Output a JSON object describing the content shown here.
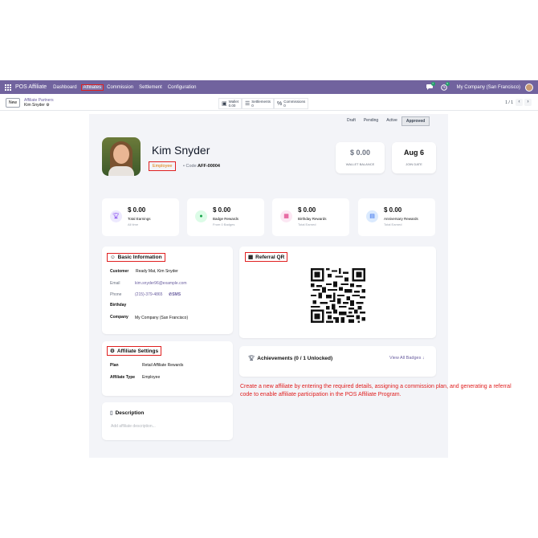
{
  "navbar": {
    "brand": "POS Affiliate",
    "menus": [
      "Dashboard",
      "Affiliates",
      "Commission",
      "Settlement",
      "Configuration"
    ],
    "active_menu_index": 1,
    "notif_count": "7",
    "activity_count": "5",
    "company": "My Company (San Francisco)"
  },
  "control": {
    "new_label": "New",
    "breadcrumb_parent": "Affiliate Partners",
    "breadcrumb_current": "Kim Snyder",
    "stats": [
      {
        "label": "Wallet",
        "value": "0.00"
      },
      {
        "label": "Settlements",
        "value": "0"
      },
      {
        "label": "Commissions",
        "value": "0"
      }
    ],
    "pager": "1 / 1"
  },
  "status": {
    "stages": [
      "Draft",
      "Pending",
      "Active",
      "Approved"
    ],
    "current_index": 3
  },
  "header": {
    "name": "Kim Snyder",
    "type_badge": "Employee",
    "code_label": "Code:",
    "code": "AFF-00004",
    "wallet_value": "$ 0.00",
    "wallet_label": "WALLET BALANCE",
    "join_value": "Aug 6",
    "join_label": "JOIN DATE"
  },
  "rewards": [
    {
      "value": "$ 0.00",
      "title": "Total Earnings",
      "sub": "All time",
      "icon": "trophy-icon",
      "color": "#ede9fe"
    },
    {
      "value": "$ 0.00",
      "title": "Badge Rewards",
      "sub": "From 0 Badges",
      "icon": "badge-icon",
      "color": "#dcfce7"
    },
    {
      "value": "$ 0.00",
      "title": "Birthday Rewards",
      "sub": "Total Earned",
      "icon": "cake-icon",
      "color": "#fce7f3"
    },
    {
      "value": "$ 0.00",
      "title": "Anniversary Rewards",
      "sub": "Total Earned",
      "icon": "calendar-icon",
      "color": "#dbeafe"
    }
  ],
  "basic": {
    "title": "Basic Information",
    "customer_label": "Customer",
    "customer": "Ready Mat, Kim Snyder",
    "email_label": "Email",
    "email": "kim.snyder96@example.com",
    "phone_label": "Phone",
    "phone": "(215)-379-4865",
    "sms": "SMS",
    "birthday_label": "Birthday",
    "company_label": "Company",
    "company": "My Company (San Francisco)"
  },
  "qr": {
    "title": "Referral QR"
  },
  "settings": {
    "title": "Affiliate Settings",
    "plan_label": "Plan",
    "plan": "Retail Affiliate Rewards",
    "type_label": "Affiliate Type",
    "type": "Employee"
  },
  "achievements": {
    "title": "Achievements (0 / 1 Unlocked)",
    "view_all": "View All Badges"
  },
  "description": {
    "title": "Description",
    "placeholder": "Add affiliate description..."
  },
  "note": "Create a new affiliate by entering the required details, assigning a commission plan, and generating a referral code to enable affiliate participation in the POS Affiliate Program."
}
